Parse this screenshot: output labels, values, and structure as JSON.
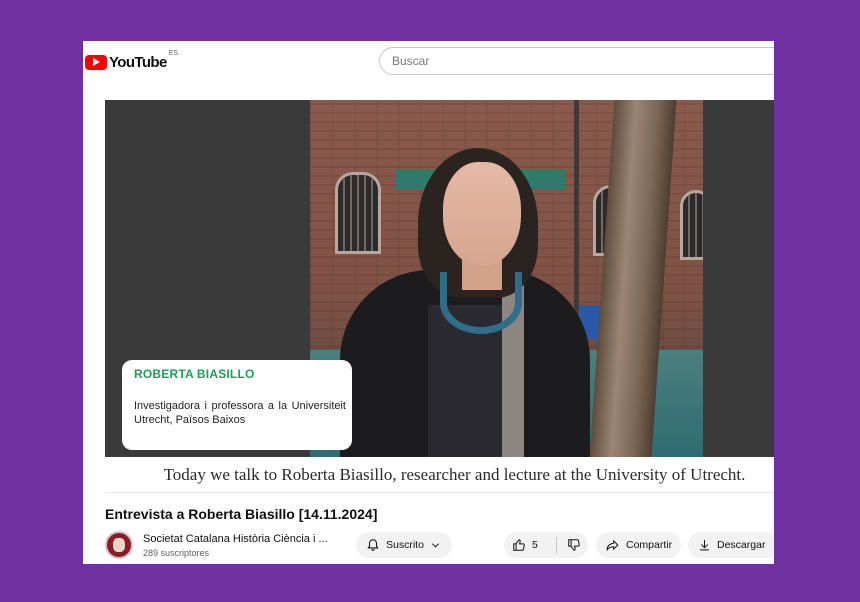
{
  "header": {
    "logo_text": "YouTube",
    "region": "ES",
    "search_placeholder": "Buscar"
  },
  "player": {
    "lower_third": {
      "name": "ROBERTA BIASILLO",
      "role": "Investigadora i professora a la Universiteit Utrecht, Països Baixos"
    },
    "caption": "Today we talk to Roberta Biasillo, researcher and lecture at the University of Utrecht."
  },
  "video": {
    "title": "Entrevista a Roberta Biasillo [14.11.2024]",
    "channel_name": "Societat Catalana Història Ciència i ...",
    "subscribers": "289 suscriptores",
    "subscribe_label": "Suscrito",
    "like_count": "5",
    "share_label": "Compartir",
    "download_label": "Descargar"
  },
  "colors": {
    "background": "#7030a0",
    "brand_red": "#ff0000",
    "name_green": "#1f9d57"
  },
  "icons": [
    "youtube-logo-icon",
    "bell-icon",
    "chevron-down-icon",
    "thumb-up-icon",
    "thumb-down-icon",
    "share-icon",
    "download-icon"
  ]
}
